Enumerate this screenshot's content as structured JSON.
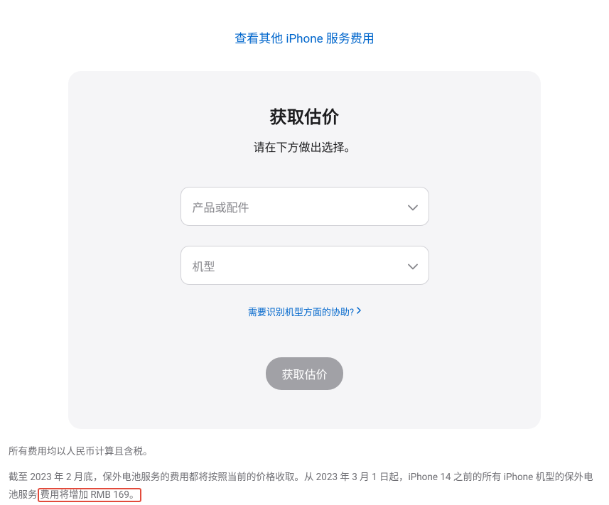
{
  "topLink": "查看其他 iPhone 服务费用",
  "card": {
    "title": "获取估价",
    "subtitle": "请在下方做出选择。",
    "productPlaceholder": "产品或配件",
    "modelPlaceholder": "机型",
    "helpLink": "需要识别机型方面的协助?",
    "submitButton": "获取估价"
  },
  "footer": {
    "line1": "所有费用均以人民币计算且含税。",
    "line2_part1": "截至 2023 年 2 月底，保外电池服务的费用都将按照当前的价格收取。从 2023 年 3 月 1 日起，iPhone 14 之前的所有 iPhone 机型的保外电池服务",
    "line2_highlighted": "费用将增加 RMB 169。"
  }
}
